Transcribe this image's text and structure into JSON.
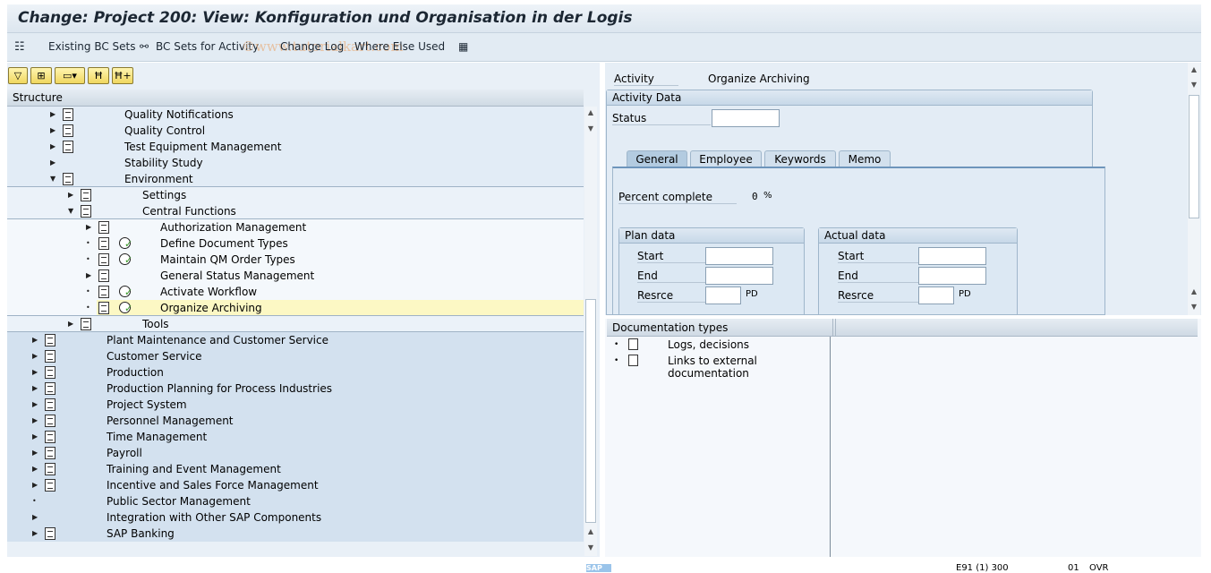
{
  "title": "Change: Project 200: View: Konfiguration und Organisation in der Logis",
  "toolbar": {
    "existing_bc_sets": "Existing BC Sets",
    "bc_sets_for_activity": "BC Sets for Activity",
    "change_log": "Change Log",
    "where_else_used": "Where Else Used"
  },
  "watermark": "©www.tutorialkart.com",
  "structure": {
    "header": "Structure",
    "rows": [
      {
        "label": "Quality Notifications",
        "level": 1,
        "node": "collapsed",
        "doc": true
      },
      {
        "label": "Quality Control",
        "level": 1,
        "node": "collapsed",
        "doc": true
      },
      {
        "label": "Test Equipment Management",
        "level": 1,
        "node": "collapsed",
        "doc": true
      },
      {
        "label": "Stability Study",
        "level": 1,
        "node": "collapsed",
        "doc": false
      },
      {
        "label": "Environment",
        "level": 1,
        "node": "expanded",
        "doc": true
      },
      {
        "label": "Settings",
        "level": 2,
        "node": "collapsed",
        "doc": true
      },
      {
        "label": "Central Functions",
        "level": 2,
        "node": "expanded",
        "doc": true
      },
      {
        "label": "Authorization Management",
        "level": 3,
        "node": "collapsed",
        "doc": true
      },
      {
        "label": "Define Document Types",
        "level": 3,
        "node": "leaf",
        "doc": true,
        "clock": true
      },
      {
        "label": "Maintain QM Order Types",
        "level": 3,
        "node": "leaf",
        "doc": true,
        "clock": true
      },
      {
        "label": "General Status Management",
        "level": 3,
        "node": "collapsed",
        "doc": true
      },
      {
        "label": "Activate Workflow",
        "level": 3,
        "node": "leaf",
        "doc": true,
        "clock": true
      },
      {
        "label": "Organize Archiving",
        "level": 3,
        "node": "leaf",
        "doc": true,
        "clock": true,
        "selected": true
      },
      {
        "label": "Tools",
        "level": 2,
        "node": "collapsed",
        "doc": true
      },
      {
        "label": "Plant Maintenance and Customer Service",
        "level": 0,
        "node": "collapsed",
        "doc": true
      },
      {
        "label": "Customer Service",
        "level": 0,
        "node": "collapsed",
        "doc": true
      },
      {
        "label": "Production",
        "level": 0,
        "node": "collapsed",
        "doc": true
      },
      {
        "label": "Production Planning for Process Industries",
        "level": 0,
        "node": "collapsed",
        "doc": true
      },
      {
        "label": "Project System",
        "level": 0,
        "node": "collapsed",
        "doc": true
      },
      {
        "label": "Personnel Management",
        "level": 0,
        "node": "collapsed",
        "doc": true
      },
      {
        "label": "Time Management",
        "level": 0,
        "node": "collapsed",
        "doc": true
      },
      {
        "label": "Payroll",
        "level": 0,
        "node": "collapsed",
        "doc": true
      },
      {
        "label": "Training and Event Management",
        "level": 0,
        "node": "collapsed",
        "doc": true
      },
      {
        "label": "Incentive and Sales Force Management",
        "level": 0,
        "node": "collapsed",
        "doc": true
      },
      {
        "label": "Public Sector Management",
        "level": 0,
        "node": "leaf",
        "doc": false
      },
      {
        "label": "Integration with Other SAP Components",
        "level": 0,
        "node": "collapsed",
        "doc": false
      },
      {
        "label": "SAP Banking",
        "level": 0,
        "node": "collapsed",
        "doc": true
      }
    ]
  },
  "activity": {
    "label": "Activity",
    "value": "Organize Archiving"
  },
  "activity_data": {
    "header": "Activity Data",
    "status_label": "Status",
    "status_value": "",
    "tabs": [
      "General",
      "Employee",
      "Keywords",
      "Memo"
    ],
    "active_tab": "General",
    "percent_label": "Percent complete",
    "percent_value": "0",
    "percent_unit": "%",
    "plan": {
      "header": "Plan data",
      "start": "Start",
      "end": "End",
      "resrce": "Resrce",
      "unit": "PD"
    },
    "actual": {
      "header": "Actual data",
      "start": "Start",
      "end": "End",
      "resrce": "Resrce",
      "unit": "PD"
    }
  },
  "doc_types": {
    "header": "Documentation types",
    "items": [
      "Logs, decisions",
      "Links to external documentation"
    ]
  },
  "statusbar": {
    "system": "E91 (1) 300",
    "client": "01",
    "mode": "OVR"
  },
  "colors": {
    "selected_row": "#fcf8c4",
    "accent_button": "#f0d760",
    "clock_check": "#3a9a2a"
  }
}
